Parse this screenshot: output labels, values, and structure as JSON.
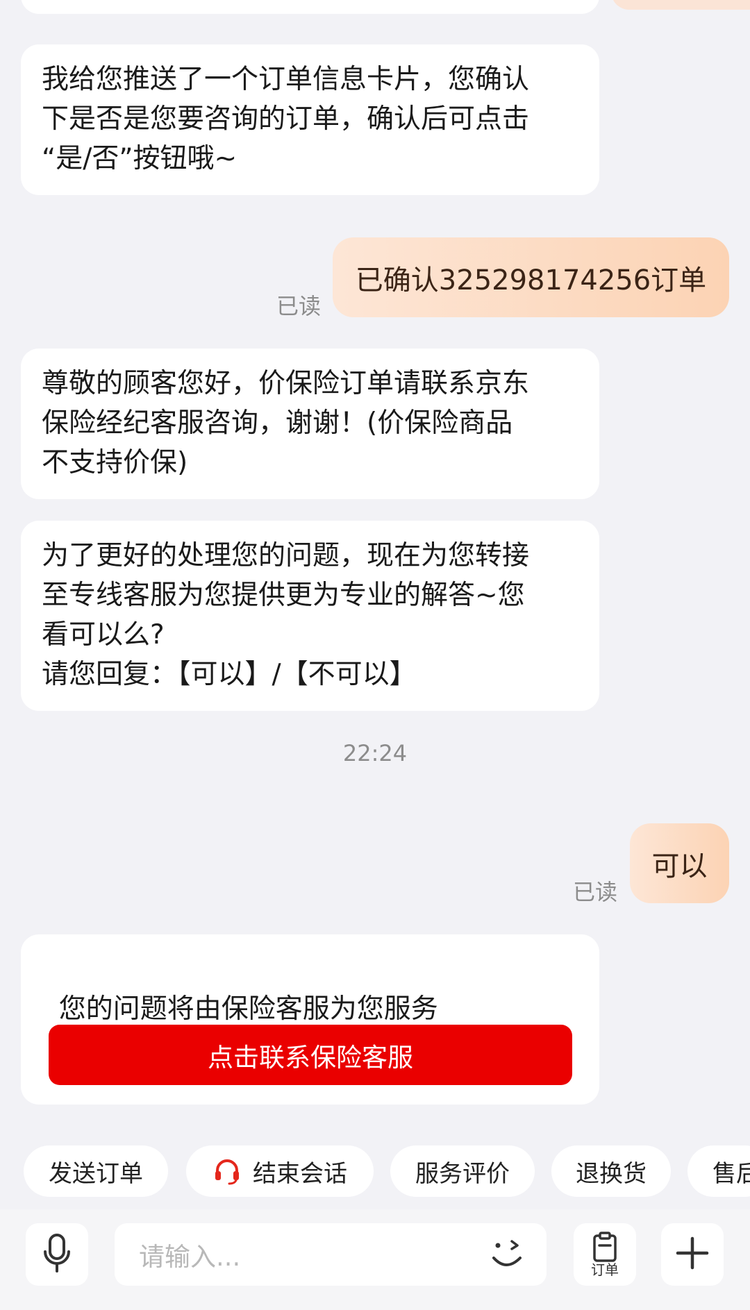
{
  "messages": {
    "agent_1": "我给您推送了一个订单信息卡片，您确认\n下是否是您要咨询的订单，确认后可点击\n“是/否”按钮哦~",
    "user_1": "已确认325298174256订单",
    "read_1": "已读",
    "agent_2": "尊敬的顾客您好，价保险订单请联系京东\n保险经纪客服咨询，谢谢！(价保险商品\n不支持价保)",
    "agent_3": "为了更好的处理您的问题，现在为您转接\n至专线客服为您提供更为专业的解答~您\n看可以么?\n请您回复：【可以】/【不可以】",
    "timestamp": "22:24",
    "user_2": "可以",
    "read_2": "已读",
    "agent_4": "您的问题将由保险客服为您服务",
    "agent_4_button": "点击联系保险客服"
  },
  "quick_actions": {
    "send_order": "发送订单",
    "end_session": "结束会话",
    "rate_service": "服务评价",
    "return_exchange": "退换货",
    "after_sales": "售后"
  },
  "input_bar": {
    "placeholder": "请输入...",
    "order_label": "订单"
  },
  "colors": {
    "accent_red": "#ea0000",
    "user_bubble": "#fcd3b4"
  }
}
